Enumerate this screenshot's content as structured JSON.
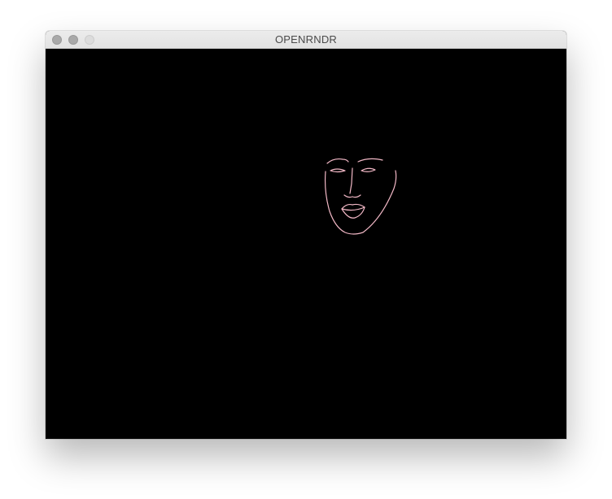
{
  "window": {
    "title": "OPENRNDR"
  },
  "controls": {
    "close_icon": "traffic-light-close",
    "minimize_icon": "traffic-light-minimize",
    "zoom_icon": "traffic-light-zoom"
  },
  "canvas": {
    "background_color": "#000000",
    "stroke_color": "#f2b8c6",
    "drawing": "face-outline"
  }
}
